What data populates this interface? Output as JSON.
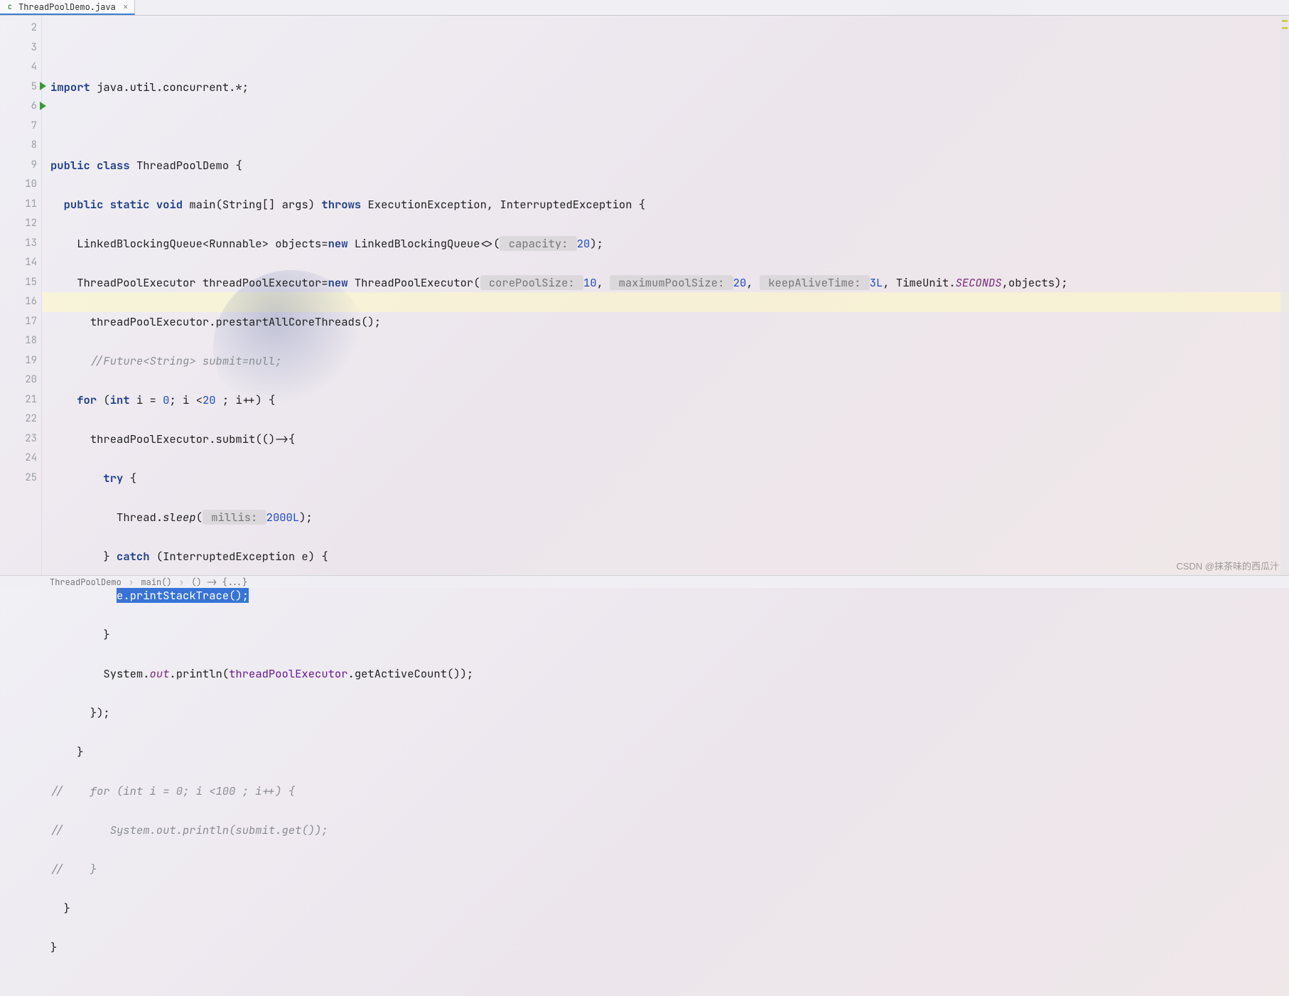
{
  "tab": {
    "filename": "ThreadPoolDemo.java",
    "icon_letter": "C"
  },
  "gutter": {
    "start": 2,
    "end": 25,
    "run_markers_at": [
      5,
      6
    ]
  },
  "highlight_line": 16,
  "code": {
    "l2": "",
    "l3": {
      "kw_import": "import",
      "rest": " java.util.concurrent.*;"
    },
    "l4": "",
    "l5": {
      "kw_public": "public",
      "kw_class": "class",
      "name": "ThreadPoolDemo",
      "open": " {"
    },
    "l6": {
      "kw_public": "public",
      "kw_static": "static",
      "kw_void": "void",
      "main": "main",
      "args": "(String[] args) ",
      "kw_throws": "throws",
      "ex": " ExecutionException, InterruptedException {"
    },
    "l7": {
      "pre": "LinkedBlockingQueue<Runnable> objects=",
      "kw_new": "new",
      "ctor": " LinkedBlockingQueue<>(",
      "hint": " capacity: ",
      "num": "20",
      "post": ");"
    },
    "l8": {
      "pre": "ThreadPoolExecutor threadPoolExecutor=",
      "kw_new": "new",
      "ctor": " ThreadPoolExecutor(",
      "h1": " corePoolSize: ",
      "n1": "10",
      "c1": ", ",
      "h2": " maximumPoolSize: ",
      "n2": "20",
      "c2": ", ",
      "h3": " keepAliveTime: ",
      "n3": "3L",
      "c3": ", TimeUnit.",
      "seconds": "SECONDS",
      "post": ",objects);"
    },
    "l9": "threadPoolExecutor.prestartAllCoreThreads();",
    "l10": "//Future<String> submit=null;",
    "l11": {
      "kw_for": "for",
      "open": " (",
      "kw_int": "int",
      "body": " i = ",
      "n0": "0",
      "mid": "; i <",
      "n20": "20",
      "rest": " ; i++) {"
    },
    "l12": "threadPoolExecutor.submit(()->{",
    "l13": {
      "kw_try": "try",
      "open": " {"
    },
    "l14": {
      "pre": "Thread.",
      "sleep": "sleep",
      "open": "(",
      "hint": " millis: ",
      "num": "2000L",
      "post": ");"
    },
    "l15": {
      "close": "} ",
      "kw_catch": "catch",
      "rest": " (InterruptedException e) {"
    },
    "l16": {
      "sel": "e.printStackTrace();"
    },
    "l17": "}",
    "l18": {
      "pre": "System.",
      "out": "out",
      "mid": ".println(",
      "ref": "threadPoolExecutor",
      "post": ".getActiveCount());"
    },
    "l19": "});",
    "l20": "}",
    "l21": "//    for (int i = 0; i <100 ; i++) {",
    "l22": "//       System.out.println(submit.get());",
    "l23": "//    }",
    "l24": "}",
    "l25": "}"
  },
  "breadcrumbs": [
    "ThreadPoolDemo",
    "main()",
    "() -> {...}"
  ],
  "watermark": "CSDN @抹茶味的西瓜汁"
}
